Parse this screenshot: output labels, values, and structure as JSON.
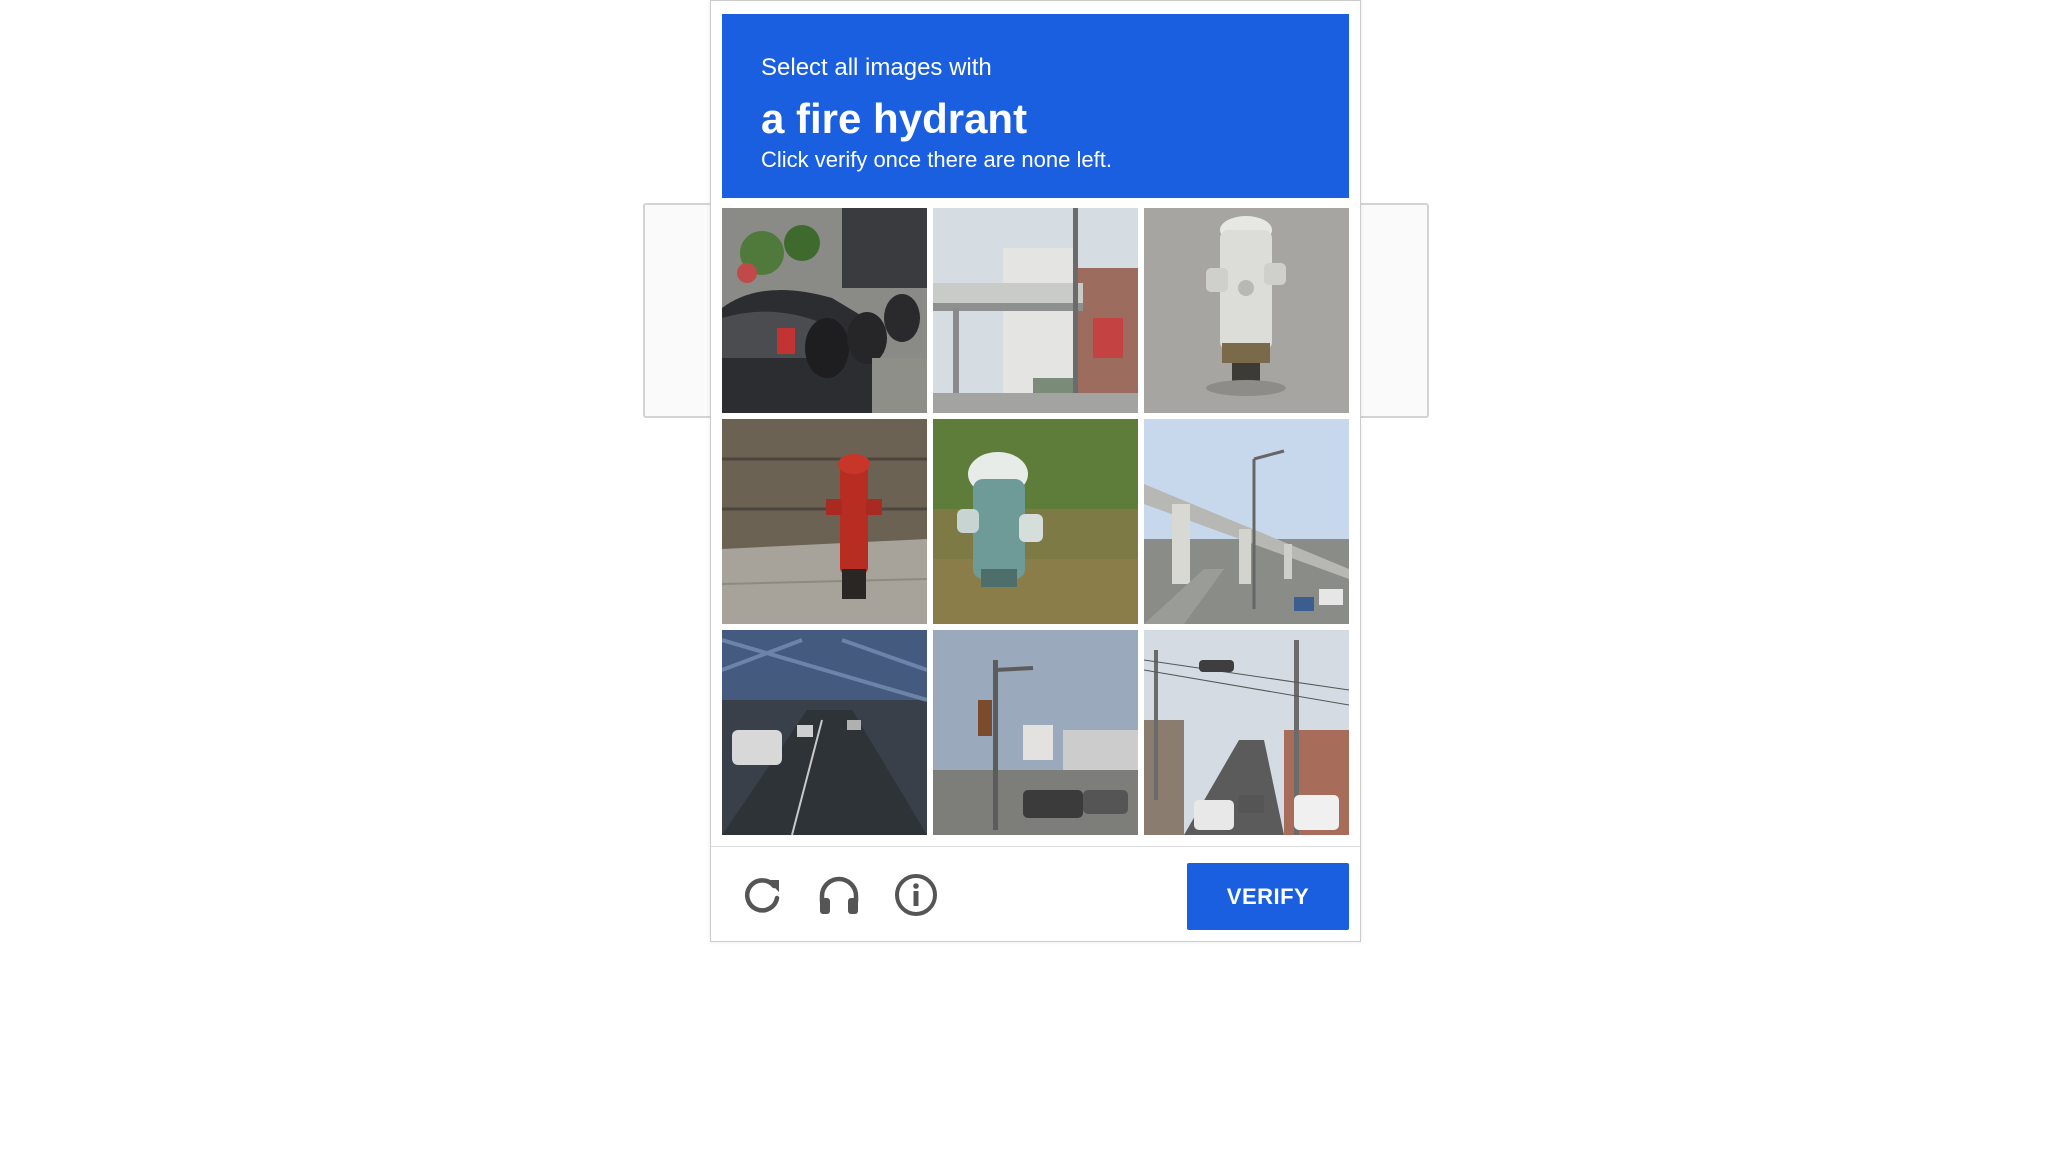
{
  "challenge": {
    "instruction_prefix": "Select all images with",
    "target_object": "a fire hydrant",
    "instruction_suffix": "Click verify once there are none left."
  },
  "grid": {
    "rows": 3,
    "columns": 3,
    "tiles": [
      {
        "index": 1,
        "content": "parked-cars-and-scooters"
      },
      {
        "index": 2,
        "content": "elevated-overpass-buildings"
      },
      {
        "index": 3,
        "content": "white-fire-hydrant"
      },
      {
        "index": 4,
        "content": "red-fire-hydrant"
      },
      {
        "index": 5,
        "content": "teal-fire-hydrant-grass"
      },
      {
        "index": 6,
        "content": "elevated-highway-road"
      },
      {
        "index": 7,
        "content": "road-under-bridge"
      },
      {
        "index": 8,
        "content": "street-traffic-light"
      },
      {
        "index": 9,
        "content": "street-with-utility-poles"
      }
    ]
  },
  "footer": {
    "reload_icon": "reload-icon",
    "audio_icon": "headphones-icon",
    "info_icon": "info-icon",
    "verify_label": "VERIFY"
  },
  "colors": {
    "accent": "#1a5fe0",
    "header_text": "#ffffff",
    "icon": "#555555"
  }
}
